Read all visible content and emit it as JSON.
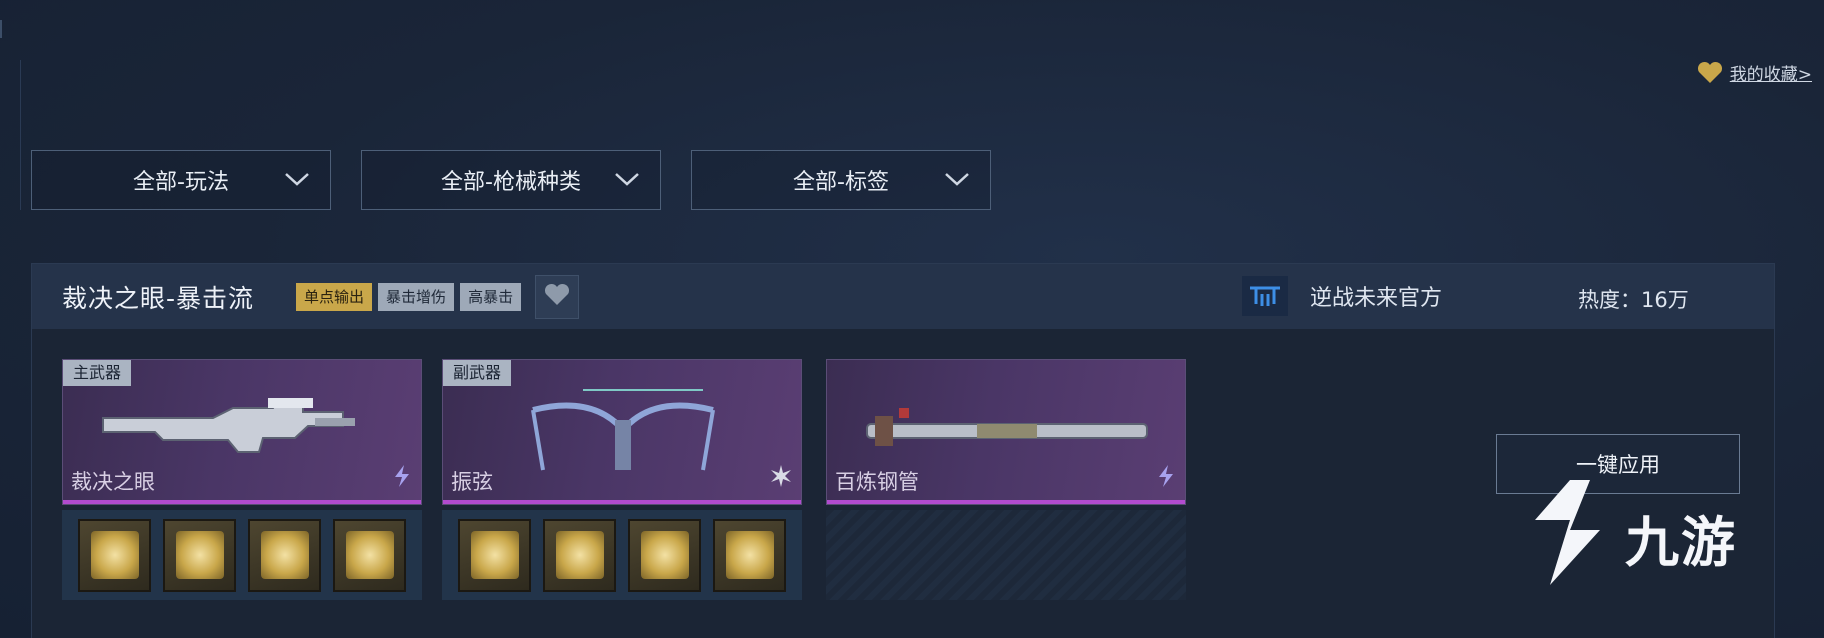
{
  "top_bar": {
    "favorites_label": "我的收藏>"
  },
  "filters": [
    {
      "label": "全部-玩法"
    },
    {
      "label": "全部-枪械种类"
    },
    {
      "label": "全部-标签"
    }
  ],
  "build": {
    "title": "裁决之眼-暴击流",
    "tags": [
      "单点输出",
      "暴击增伤",
      "高暴击"
    ],
    "author": "逆战未来官方",
    "heat": "热度：16万",
    "apply_label": "一键应用",
    "weapons": [
      {
        "slot": "主武器",
        "name": "裁决之眼",
        "type_icon": "lightning-icon",
        "mods": [
          "mod-icon",
          "mod-icon",
          "mod-icon",
          "mod-icon"
        ]
      },
      {
        "slot": "副武器",
        "name": "振弦",
        "type_icon": "burst-icon",
        "mods": [
          "mod-icon",
          "mod-icon",
          "mod-icon",
          "mod-icon"
        ]
      },
      {
        "slot": "",
        "name": "百炼钢管",
        "type_icon": "lightning-icon",
        "mods": []
      }
    ]
  },
  "watermark": "九游",
  "colors": {
    "background": "#1a2538",
    "gold": "#c9a74a",
    "accent_purple": "#b24bcf"
  }
}
